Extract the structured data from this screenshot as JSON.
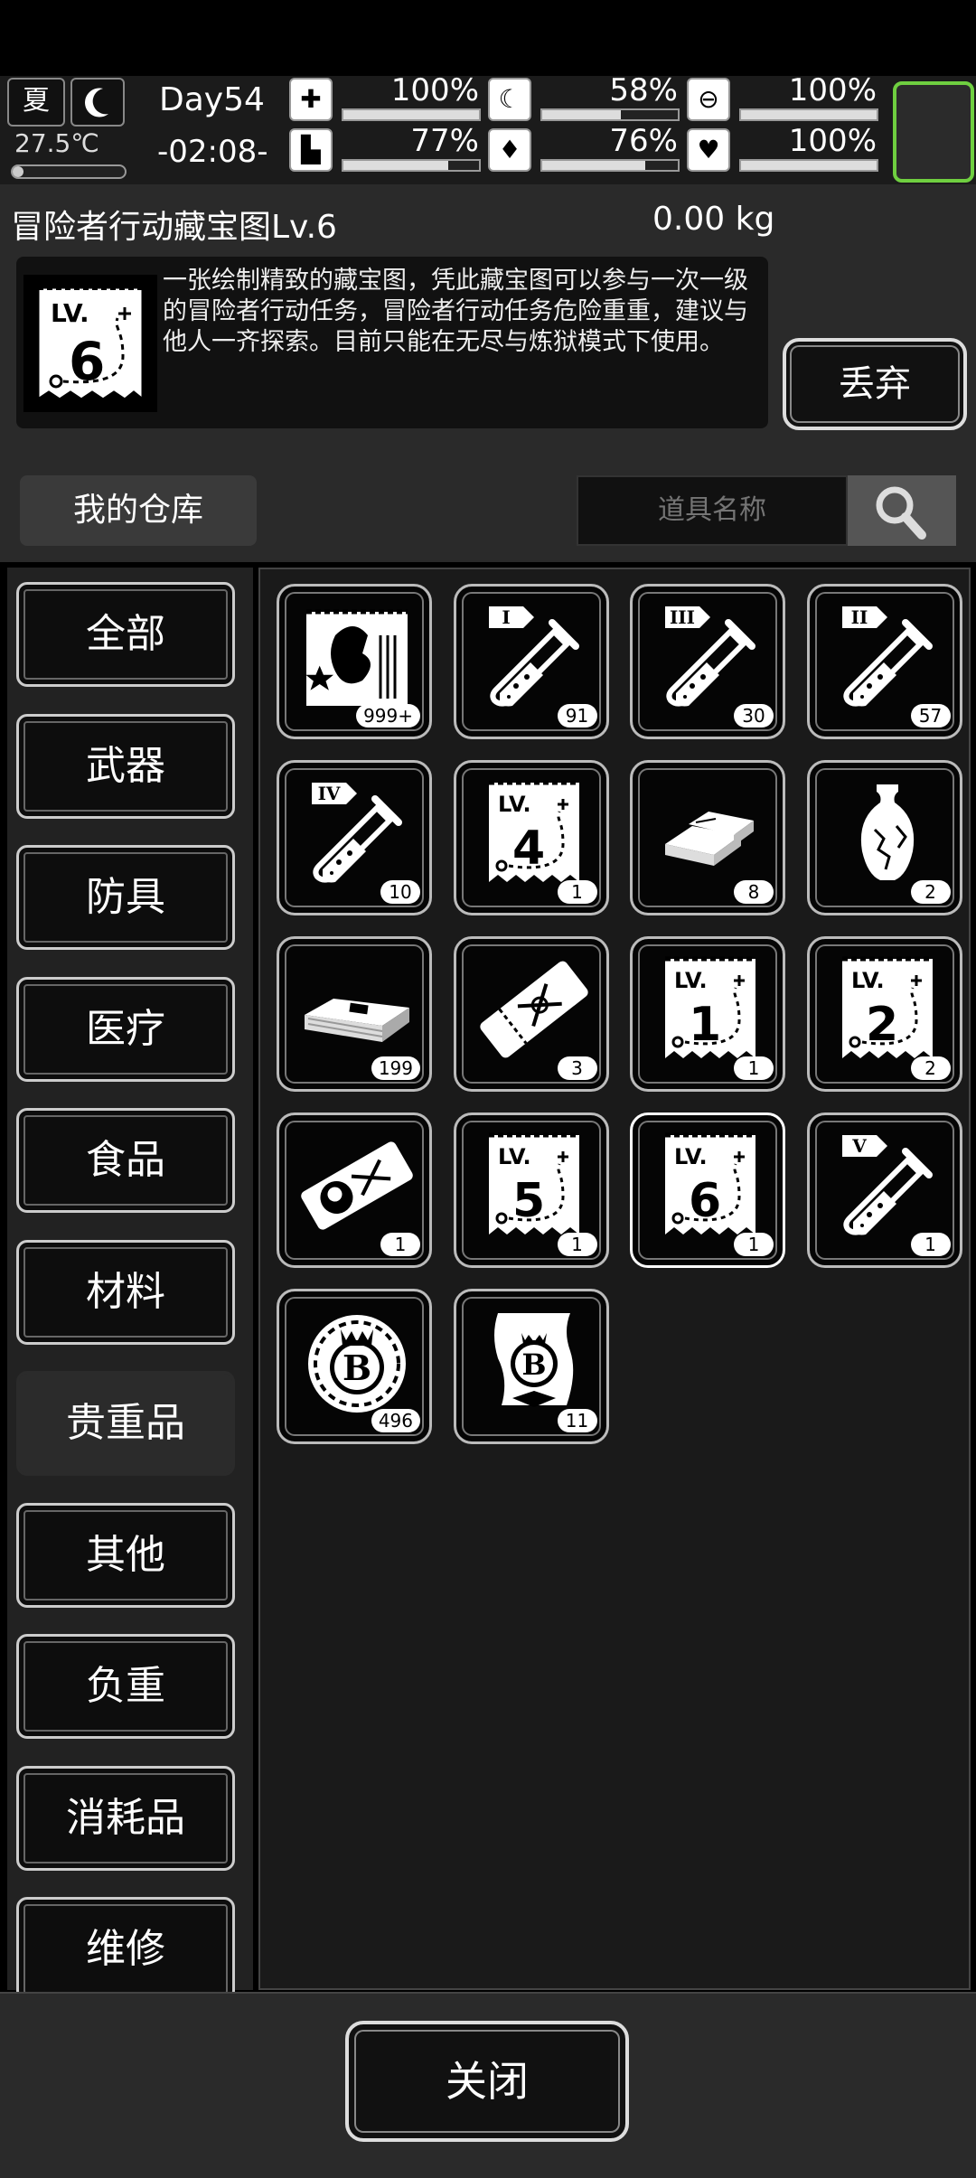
{
  "status": {
    "season": "夏",
    "temperature": "27.5℃",
    "temperature_level": 0.1,
    "day": "Day54",
    "time": "-02:08-",
    "stats": [
      {
        "icon": "medkit-icon",
        "value": "100%",
        "level": 1.0
      },
      {
        "icon": "stomach-icon",
        "value": "58%",
        "level": 0.58
      },
      {
        "icon": "pill-icon",
        "value": "100%",
        "level": 1.0
      },
      {
        "icon": "boot-icon",
        "value": "77%",
        "level": 0.77
      },
      {
        "icon": "water-drop-icon",
        "value": "76%",
        "level": 0.76
      },
      {
        "icon": "heart-icon",
        "value": "100%",
        "level": 1.0
      }
    ]
  },
  "item": {
    "name": "冒险者行动藏宝图Lv.6",
    "weight": "0.00 kg",
    "description": "一张绘制精致的藏宝图，凭此藏宝图可以参与一次一级的冒险者行动任务，冒险者行动任务危险重重，建议与他人一齐探索。目前只能在无尽与炼狱模式下使用。",
    "discard_label": "丢弃"
  },
  "warehouse": {
    "title": "我的仓库",
    "search_placeholder": "道具名称"
  },
  "categories": [
    "全部",
    "武器",
    "防具",
    "医疗",
    "食品",
    "材料",
    "贵重品",
    "其他",
    "负重",
    "消耗品",
    "维修"
  ],
  "active_category": "贵重品",
  "items": [
    {
      "icon": "treasure-map-pile-icon",
      "count": "999+"
    },
    {
      "icon": "test-tube-I-icon",
      "count": "91",
      "tag": "I"
    },
    {
      "icon": "test-tube-III-icon",
      "count": "30",
      "tag": "III"
    },
    {
      "icon": "test-tube-II-icon",
      "count": "57",
      "tag": "II"
    },
    {
      "icon": "test-tube-IV-icon",
      "count": "10",
      "tag": "IV"
    },
    {
      "icon": "treasure-map-lv4-icon",
      "count": "1",
      "level": "4"
    },
    {
      "icon": "gold-bars-icon",
      "count": "8"
    },
    {
      "icon": "vase-icon",
      "count": "2"
    },
    {
      "icon": "cash-stack-icon",
      "count": "199"
    },
    {
      "icon": "ticket-icon",
      "count": "3"
    },
    {
      "icon": "treasure-map-lv1-icon",
      "count": "1",
      "level": "1"
    },
    {
      "icon": "treasure-map-lv2-icon",
      "count": "2",
      "level": "2"
    },
    {
      "icon": "portrait-ticket-icon",
      "count": "1"
    },
    {
      "icon": "treasure-map-lv5-icon",
      "count": "1",
      "level": "5"
    },
    {
      "icon": "treasure-map-lv6-icon",
      "count": "1",
      "level": "6"
    },
    {
      "icon": "test-tube-V-icon",
      "count": "1",
      "tag": "V"
    },
    {
      "icon": "b-coin-icon",
      "count": "496"
    },
    {
      "icon": "b-scroll-icon",
      "count": "11"
    }
  ],
  "selected_item": 14,
  "close_label": "关闭"
}
